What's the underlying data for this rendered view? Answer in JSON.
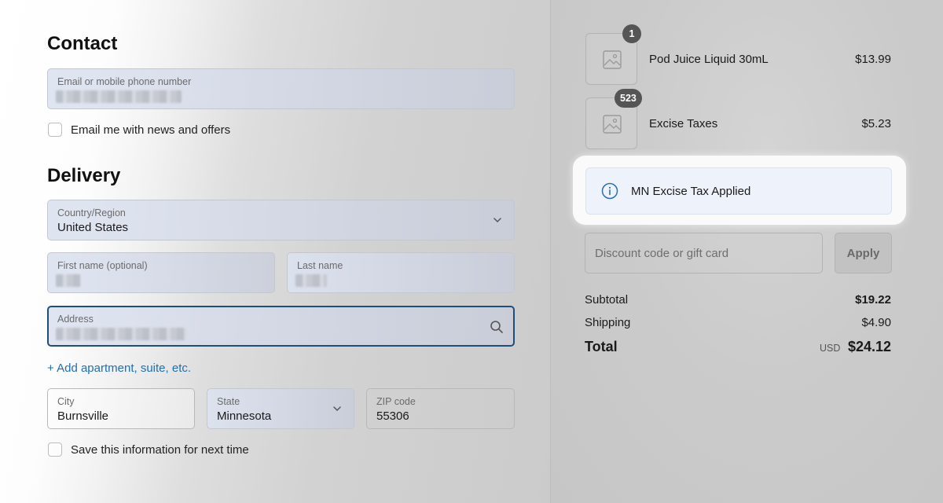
{
  "contact": {
    "heading": "Contact",
    "email_label": "Email or mobile phone number",
    "news_label": "Email me with news and offers"
  },
  "delivery": {
    "heading": "Delivery",
    "country_label": "Country/Region",
    "country_value": "United States",
    "first_name_label": "First name (optional)",
    "last_name_label": "Last name",
    "address_label": "Address",
    "add_apartment_link": "+ Add apartment, suite, etc.",
    "city_label": "City",
    "city_value": "Burnsville",
    "state_label": "State",
    "state_value": "Minnesota",
    "zip_label": "ZIP code",
    "zip_value": "55306",
    "save_info_label": "Save this information for next time"
  },
  "order": {
    "items": [
      {
        "quantity": "1",
        "name": "Pod Juice Liquid 30mL",
        "price": "$13.99"
      },
      {
        "quantity": "523",
        "name": "Excise Taxes",
        "price": "$5.23"
      }
    ],
    "notice": "MN Excise Tax Applied",
    "discount_placeholder": "Discount code or gift card",
    "apply_label": "Apply",
    "subtotal_label": "Subtotal",
    "subtotal_value": "$19.22",
    "shipping_label": "Shipping",
    "shipping_value": "$4.90",
    "total_label": "Total",
    "currency": "USD",
    "total_value": "$24.12"
  },
  "colors": {
    "link": "#1f6fb2",
    "focus_border": "#1f4e79",
    "notice_bg": "#eef3fb",
    "info_icon": "#2a6fb0"
  },
  "icons": [
    "chevron-down-icon",
    "search-icon",
    "image-placeholder-icon",
    "info-icon"
  ]
}
